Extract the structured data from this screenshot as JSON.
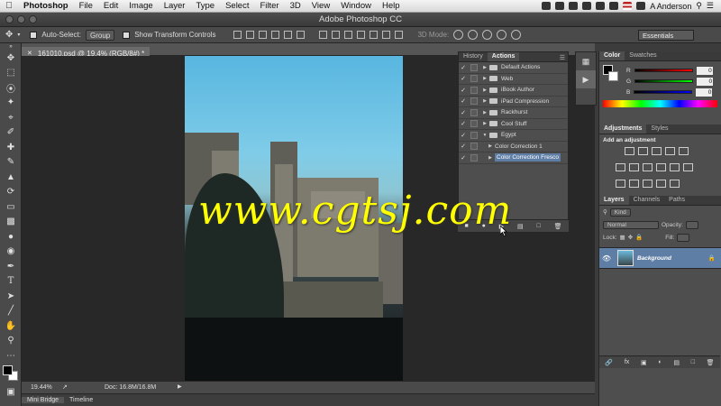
{
  "menubar": {
    "app": "Photoshop",
    "items": [
      "File",
      "Edit",
      "Image",
      "Layer",
      "Type",
      "Select",
      "Filter",
      "3D",
      "View",
      "Window",
      "Help"
    ],
    "user": "A Anderson"
  },
  "window": {
    "title": "Adobe Photoshop CC"
  },
  "options": {
    "auto_select_label": "Auto-Select:",
    "auto_select_value": "Group",
    "show_transform_label": "Show Transform Controls",
    "mode_label": "3D Mode:",
    "workspace": "Essentials"
  },
  "document": {
    "tab_label": "161010.psd @ 19.4% (RGB/8#) *",
    "zoom": "19.44%",
    "doc_size": "Doc: 16.8M/16.8M"
  },
  "bottom_tabs": [
    "Mini Bridge",
    "Timeline"
  ],
  "actions_panel": {
    "tabs": [
      "History",
      "Actions"
    ],
    "rows": [
      {
        "label": "Default Actions",
        "checked": true,
        "type": "set"
      },
      {
        "label": "Web",
        "checked": true,
        "type": "set"
      },
      {
        "label": "iBook Author",
        "checked": true,
        "type": "set"
      },
      {
        "label": "iPad Compression",
        "checked": true,
        "type": "set"
      },
      {
        "label": "Rackhurst",
        "checked": true,
        "type": "set"
      },
      {
        "label": "Cool Stuff",
        "checked": true,
        "type": "set"
      },
      {
        "label": "Egypt",
        "checked": true,
        "type": "open-set"
      },
      {
        "label": "Color Correction 1",
        "checked": true,
        "type": "action"
      },
      {
        "label": "Color Correction Fresco",
        "checked": true,
        "type": "action-selected"
      }
    ]
  },
  "color_panel": {
    "tabs": [
      "Color",
      "Swatches"
    ],
    "channels": [
      {
        "label": "R",
        "value": "0"
      },
      {
        "label": "G",
        "value": "0"
      },
      {
        "label": "B",
        "value": "0"
      }
    ]
  },
  "adjustments_panel": {
    "tabs": [
      "Adjustments",
      "Styles"
    ],
    "heading": "Add an adjustment"
  },
  "layers_panel": {
    "tabs": [
      "Layers",
      "Channels",
      "Paths"
    ],
    "kind_label": "Kind",
    "blend_mode": "Normal",
    "opacity_label": "Opacity:",
    "lock_label": "Lock:",
    "fill_label": "Fill:",
    "layer_name": "Background"
  },
  "watermark": "www.cgtsj.com",
  "colors": {
    "ui_bg": "#4e4e4e",
    "selected": "#5f7ea6",
    "watermark": "#ffff00"
  }
}
